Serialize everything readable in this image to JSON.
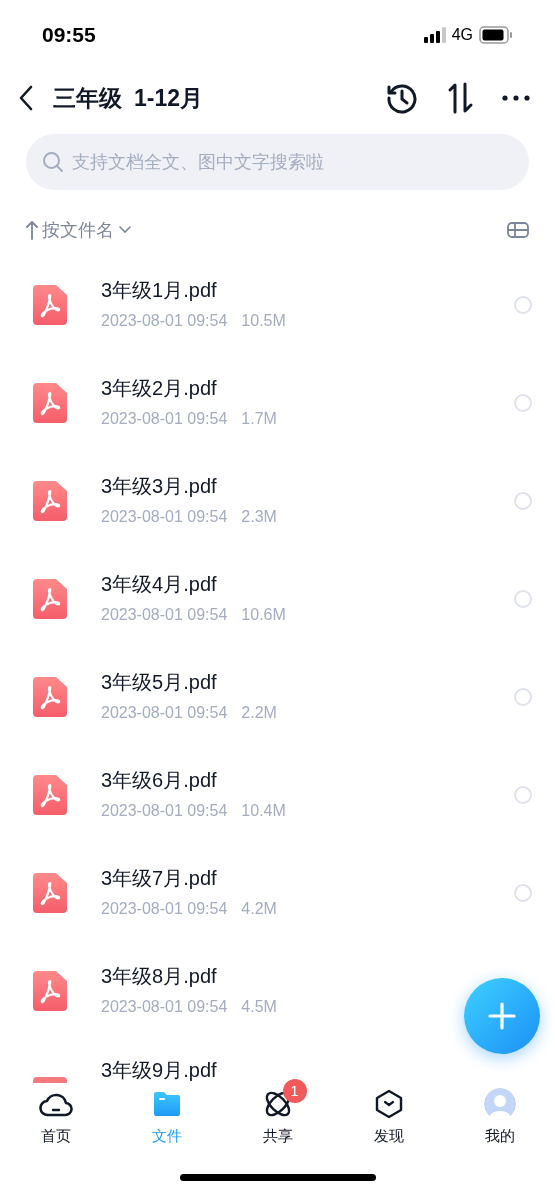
{
  "status_bar": {
    "time": "09:55",
    "network": "4G"
  },
  "header": {
    "title": "三年级",
    "subtitle": "1-12月"
  },
  "search": {
    "placeholder": "支持文档全文、图中文字搜索啦"
  },
  "sort": {
    "label": "按文件名"
  },
  "files": [
    {
      "name": "3年级1月.pdf",
      "date": "2023-08-01 09:54",
      "size": "10.5M",
      "selected": false
    },
    {
      "name": "3年级2月.pdf",
      "date": "2023-08-01 09:54",
      "size": "1.7M",
      "selected": false
    },
    {
      "name": "3年级3月.pdf",
      "date": "2023-08-01 09:54",
      "size": "2.3M",
      "selected": false
    },
    {
      "name": "3年级4月.pdf",
      "date": "2023-08-01 09:54",
      "size": "10.6M",
      "selected": false
    },
    {
      "name": "3年级5月.pdf",
      "date": "2023-08-01 09:54",
      "size": "2.2M",
      "selected": false
    },
    {
      "name": "3年级6月.pdf",
      "date": "2023-08-01 09:54",
      "size": "10.4M",
      "selected": false
    },
    {
      "name": "3年级7月.pdf",
      "date": "2023-08-01 09:54",
      "size": "4.2M",
      "selected": false
    },
    {
      "name": "3年级8月.pdf",
      "date": "2023-08-01 09:54",
      "size": "4.5M"
    },
    {
      "name": "3年级9月.pdf"
    }
  ],
  "tabs": [
    {
      "kind": "home",
      "label": "首页",
      "selected": false
    },
    {
      "kind": "files",
      "label": "文件",
      "selected": true
    },
    {
      "kind": "share",
      "label": "共享",
      "selected": false,
      "badge": "1"
    },
    {
      "kind": "discover",
      "label": "发现",
      "selected": false
    },
    {
      "kind": "me",
      "label": "我的",
      "selected": false
    }
  ]
}
